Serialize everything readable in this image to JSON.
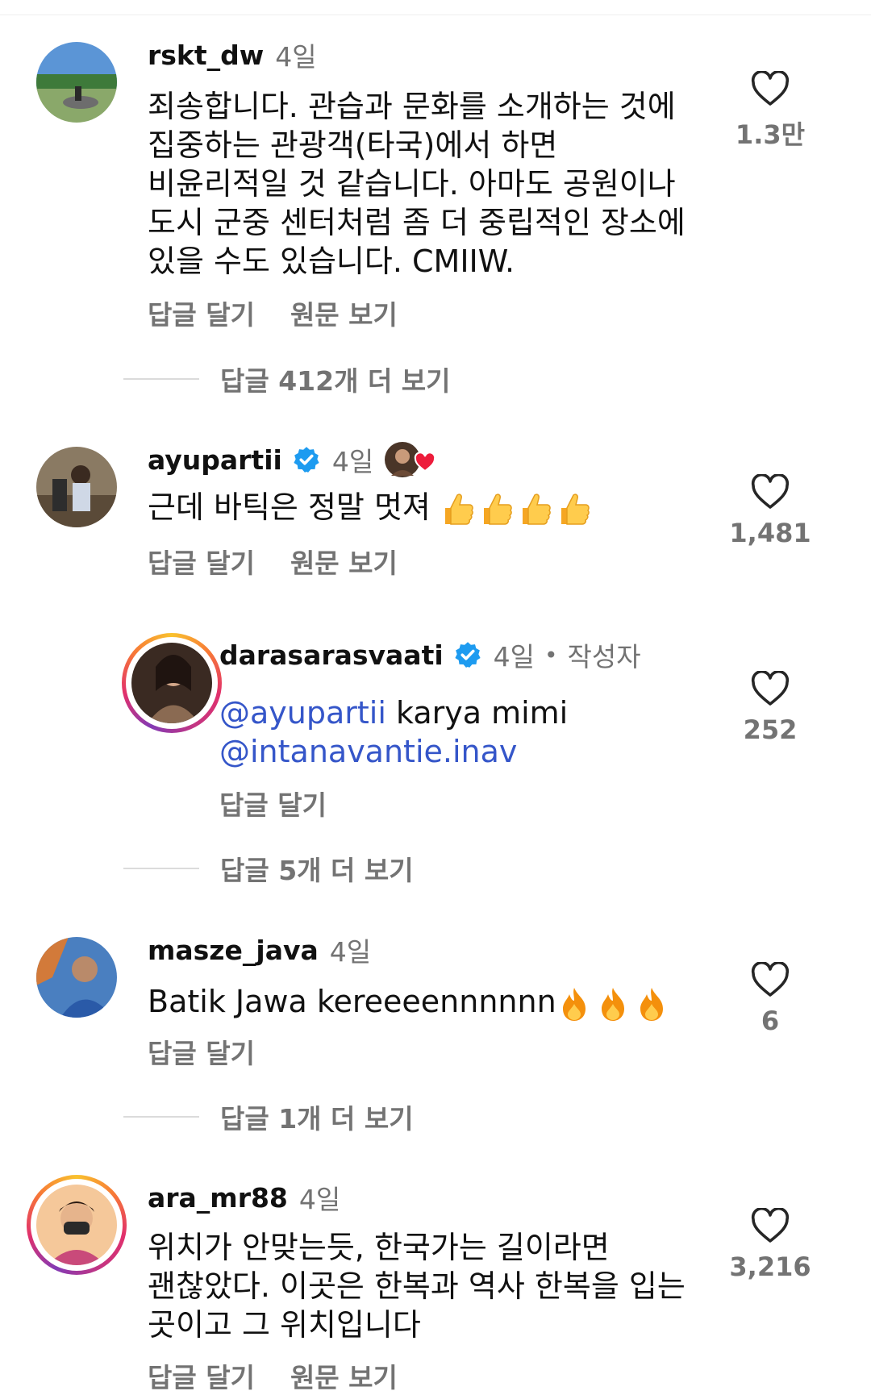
{
  "comments": [
    {
      "username": "rskt_dw",
      "time": "4일",
      "lines": [
        "죄송합니다. 관습과 문화를 소개하는 것에",
        "집중하는 관광객(타국)에서 하면",
        "비윤리적일 것 같습니다. 아마도 공원이나",
        "도시 군중 센터처럼 좀 더 중립적인 장소에",
        "있을 수도 있습니다. CMIIW."
      ],
      "reply_label": "답글 달기",
      "original_label": "원문 보기",
      "likes": "1.3만",
      "more_replies": "답글 412개 더 보기"
    },
    {
      "username": "ayupartii",
      "time": "4일",
      "text": "근데 바틱은 정말 멋져",
      "emojis": [
        "thumbs-up",
        "thumbs-up",
        "thumbs-up",
        "thumbs-up"
      ],
      "reply_label": "답글 달기",
      "original_label": "원문 보기",
      "likes": "1,481"
    },
    {
      "username": "darasarasvaati",
      "time": "4일",
      "author_tag": "작성자",
      "mention1": "@ayupartii",
      "text_after_mention1": " karya mimi",
      "mention2": "@intanavantie.inav",
      "reply_label": "답글 달기",
      "likes": "252",
      "more_replies": "답글 5개 더 보기"
    },
    {
      "username": "masze_java",
      "time": "4일",
      "text": "Batik Jawa kereeeennnnnn",
      "emojis": [
        "fire",
        "fire",
        "fire"
      ],
      "reply_label": "답글 달기",
      "likes": "6",
      "more_replies": "답글 1개 더 보기"
    },
    {
      "username": "ara_mr88",
      "time": "4일",
      "lines": [
        "위치가 안맞는듯, 한국가는 길이라면",
        "괜찮았다. 이곳은 한복과 역사 한복을 입는",
        "곳이고 그 위치입니다"
      ],
      "reply_label": "답글 달기",
      "original_label": "원문 보기",
      "likes": "3,216"
    }
  ],
  "colors": {
    "text": "#111111",
    "secondary": "#737373",
    "mention": "#3556c9",
    "verified": "#1d9bf0"
  }
}
